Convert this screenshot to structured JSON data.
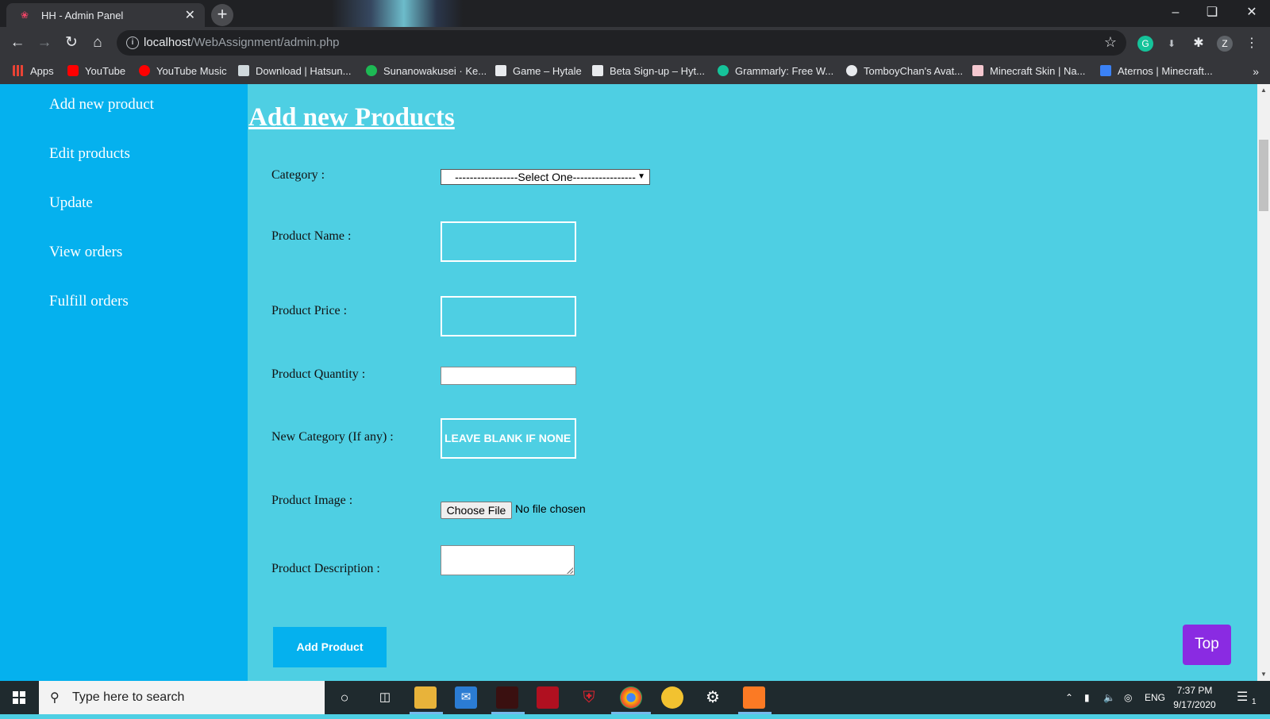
{
  "browser": {
    "tab_title": "HH - Admin Panel",
    "tab_close": "✕",
    "new_tab": "+",
    "url_host": "localhost",
    "url_path": "/WebAssignment/admin.php",
    "profile_initial": "Z",
    "bookmarks": [
      {
        "label": "Apps",
        "icon": "apps-grid-icon",
        "color": "#4285f4"
      },
      {
        "label": "YouTube",
        "icon": "youtube-icon",
        "color": "#ff0000"
      },
      {
        "label": "YouTube Music",
        "icon": "youtube-music-icon",
        "color": "#ff0000"
      },
      {
        "label": "Download | Hatsun...",
        "icon": "page-icon",
        "color": "#cfd8dc"
      },
      {
        "label": "Sunanowakusei · Ke...",
        "icon": "spotify-icon",
        "color": "#1db954"
      },
      {
        "label": "Game – Hytale",
        "icon": "hytale-icon",
        "color": "#e8eaed"
      },
      {
        "label": "Beta Sign-up – Hyt...",
        "icon": "hytale-icon",
        "color": "#e8eaed"
      },
      {
        "label": "Grammarly: Free W...",
        "icon": "grammarly-icon",
        "color": "#15c39a"
      },
      {
        "label": "TomboyChan's Avat...",
        "icon": "globe-icon",
        "color": "#e8eaed"
      },
      {
        "label": "Minecraft Skin | Na...",
        "icon": "minecraft-icon",
        "color": "#f4c7cf"
      },
      {
        "label": "Aternos | Minecraft...",
        "icon": "aternos-icon",
        "color": "#3b82f6"
      }
    ],
    "bookmarks_more": "»"
  },
  "sidebar": {
    "items": [
      {
        "label": "Add new product"
      },
      {
        "label": "Edit products"
      },
      {
        "label": "Update"
      },
      {
        "label": "View orders"
      },
      {
        "label": "Fulfill orders"
      }
    ]
  },
  "form": {
    "title": "Add new Products",
    "category_label": "Category :",
    "category_selected": "-----------------Select One-----------------",
    "name_label": "Product Name :",
    "price_label": "Product Price :",
    "quantity_label": "Product Quantity :",
    "new_category_label": "New Category (If any) :",
    "new_category_placeholder": "LEAVE BLANK IF NONE",
    "image_label": "Product Image :",
    "choose_file": "Choose File",
    "no_file": "No file chosen",
    "description_label": "Product Description :",
    "submit": "Add Product"
  },
  "top_button": "Top",
  "taskbar": {
    "search_placeholder": "Type here to search",
    "language": "ENG",
    "time": "7:37 PM",
    "date": "9/17/2020",
    "notifications": "1"
  },
  "colors": {
    "page_bg": "#4ecfe3",
    "sidebar_bg": "#05b1ee",
    "top_button_bg": "#8a2be2",
    "browser_chrome": "#35363a"
  }
}
